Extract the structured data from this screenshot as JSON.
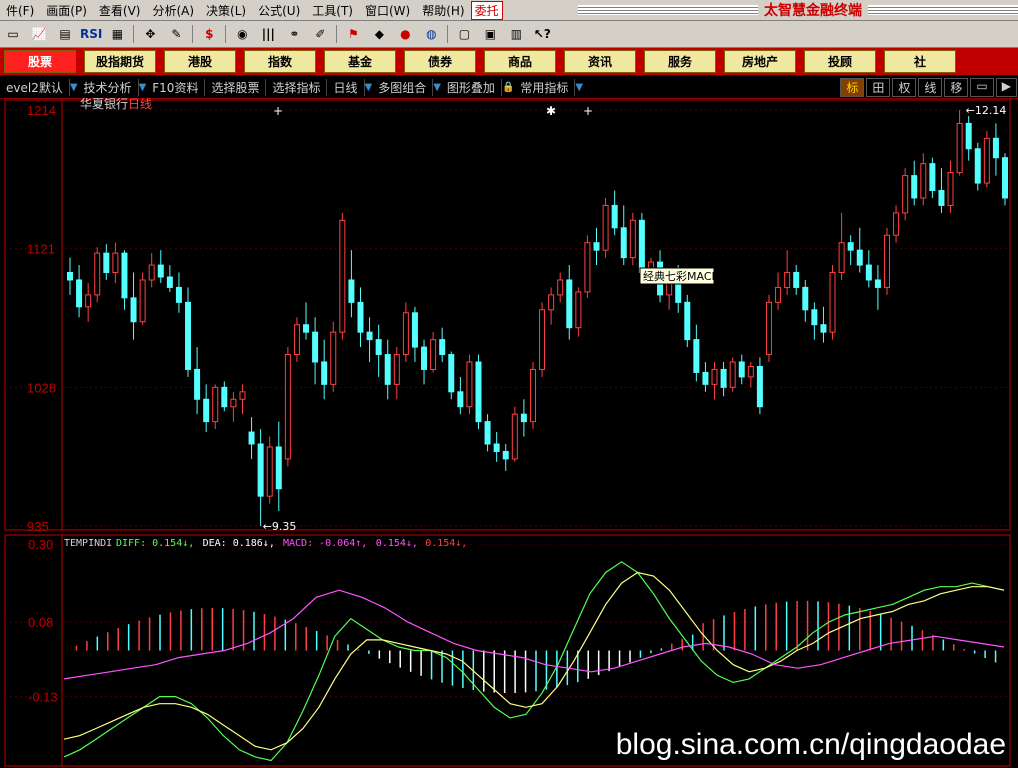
{
  "menubar": {
    "items": [
      "件(F)",
      "画面(P)",
      "查看(V)",
      "分析(A)",
      "决策(L)",
      "公式(U)",
      "工具(T)",
      "窗口(W)",
      "帮助(H)",
      "委托"
    ],
    "brand_title": "太智慧金融终端"
  },
  "toolbar": {
    "icons": [
      {
        "name": "chart-icon",
        "glyph": "▭"
      },
      {
        "name": "kline-icon",
        "glyph": "📈"
      },
      {
        "name": "minute-icon",
        "glyph": "▤"
      },
      {
        "name": "rsi-icon",
        "glyph": "RSI"
      },
      {
        "name": "grid-icon",
        "glyph": "▦"
      },
      {
        "name": "crosshair-icon",
        "glyph": "✥"
      },
      {
        "name": "ruler-icon",
        "glyph": "✎"
      },
      {
        "name": "dollar-icon",
        "glyph": "$"
      },
      {
        "name": "tape-icon",
        "glyph": "◉"
      },
      {
        "name": "bars-icon",
        "glyph": "|||"
      },
      {
        "name": "binoculars-icon",
        "glyph": "⚭"
      },
      {
        "name": "pen-icon",
        "glyph": "✐"
      },
      {
        "name": "flag-icon",
        "glyph": "⚑"
      },
      {
        "name": "diamond-icon",
        "glyph": "◆"
      },
      {
        "name": "record-icon",
        "glyph": "●"
      },
      {
        "name": "disc-icon",
        "glyph": "◍"
      },
      {
        "name": "folder-icon",
        "glyph": "▢"
      },
      {
        "name": "window-icon",
        "glyph": "▣"
      },
      {
        "name": "books-icon",
        "glyph": "▥"
      },
      {
        "name": "help-cursor-icon",
        "glyph": "↖?"
      }
    ]
  },
  "navbar": {
    "items": [
      "股票",
      "股指期货",
      "港股",
      "指数",
      "基金",
      "债券",
      "商品",
      "资讯",
      "服务",
      "房地产",
      "投顾",
      "社"
    ]
  },
  "subbar": {
    "items": [
      "evel2默认",
      "技术分析",
      "F10资料",
      "选择股票",
      "选择指标",
      "日线",
      "多图组合",
      "图形叠加",
      "常用指标"
    ],
    "modes": [
      "标",
      "田",
      "权",
      "线",
      "移",
      "▭",
      "▶"
    ]
  },
  "chart_data": [
    {
      "type": "candlestick",
      "title": "华夏银行",
      "period_label": "日线",
      "y_ticks": [
        "1214",
        "1121",
        "1028",
        "935"
      ],
      "ylim": [
        9.35,
        12.14
      ],
      "high_label": "12.14",
      "low_label": "9.35",
      "tooltip": "经典七彩MACD",
      "colors": {
        "up": "#ff4040",
        "down": "#54ffff",
        "axis": "#c00000"
      },
      "candles": [
        [
          11.05,
          11.15,
          10.9,
          11.0
        ],
        [
          11.0,
          11.1,
          10.75,
          10.82
        ],
        [
          10.82,
          10.98,
          10.72,
          10.9
        ],
        [
          10.9,
          11.22,
          10.85,
          11.18
        ],
        [
          11.18,
          11.24,
          11.0,
          11.05
        ],
        [
          11.05,
          11.25,
          10.98,
          11.18
        ],
        [
          11.18,
          11.2,
          10.8,
          10.88
        ],
        [
          10.88,
          11.05,
          10.6,
          10.72
        ],
        [
          10.72,
          11.05,
          10.7,
          11.0
        ],
        [
          11.0,
          11.18,
          10.95,
          11.1
        ],
        [
          11.1,
          11.2,
          10.98,
          11.02
        ],
        [
          11.02,
          11.1,
          10.92,
          10.95
        ],
        [
          10.95,
          11.05,
          10.78,
          10.85
        ],
        [
          10.85,
          10.95,
          10.35,
          10.4
        ],
        [
          10.4,
          10.55,
          10.1,
          10.2
        ],
        [
          10.2,
          10.3,
          9.98,
          10.05
        ],
        [
          10.05,
          10.3,
          10.0,
          10.28
        ],
        [
          10.28,
          10.32,
          10.12,
          10.15
        ],
        [
          10.15,
          10.25,
          10.05,
          10.2
        ],
        [
          10.2,
          10.3,
          10.1,
          10.25
        ],
        [
          9.98,
          10.08,
          9.8,
          9.9
        ],
        [
          9.9,
          10.0,
          9.35,
          9.55
        ],
        [
          9.55,
          9.95,
          9.5,
          9.88
        ],
        [
          9.88,
          10.05,
          9.45,
          9.6
        ],
        [
          9.8,
          10.55,
          9.75,
          10.5
        ],
        [
          10.5,
          10.75,
          10.45,
          10.7
        ],
        [
          10.7,
          10.85,
          10.6,
          10.65
        ],
        [
          10.65,
          10.75,
          10.3,
          10.45
        ],
        [
          10.45,
          10.6,
          10.2,
          10.3
        ],
        [
          10.3,
          10.72,
          10.25,
          10.65
        ],
        [
          10.65,
          11.45,
          10.6,
          11.4
        ],
        [
          11.0,
          11.2,
          10.75,
          10.85
        ],
        [
          10.85,
          10.95,
          10.55,
          10.65
        ],
        [
          10.65,
          10.75,
          10.45,
          10.6
        ],
        [
          10.6,
          10.7,
          10.35,
          10.5
        ],
        [
          10.5,
          10.6,
          10.2,
          10.3
        ],
        [
          10.3,
          10.55,
          10.2,
          10.5
        ],
        [
          10.5,
          10.85,
          10.45,
          10.78
        ],
        [
          10.78,
          10.82,
          10.45,
          10.55
        ],
        [
          10.55,
          10.6,
          10.3,
          10.4
        ],
        [
          10.4,
          10.65,
          10.38,
          10.6
        ],
        [
          10.6,
          10.68,
          10.45,
          10.5
        ],
        [
          10.5,
          10.52,
          10.2,
          10.25
        ],
        [
          10.25,
          10.35,
          10.1,
          10.15
        ],
        [
          10.15,
          10.5,
          10.1,
          10.45
        ],
        [
          10.45,
          10.5,
          10.0,
          10.05
        ],
        [
          10.05,
          10.1,
          9.85,
          9.9
        ],
        [
          9.9,
          9.98,
          9.78,
          9.85
        ],
        [
          9.85,
          9.9,
          9.72,
          9.8
        ],
        [
          9.8,
          10.15,
          9.78,
          10.1
        ],
        [
          10.1,
          10.2,
          9.95,
          10.05
        ],
        [
          10.05,
          10.45,
          10.0,
          10.4
        ],
        [
          10.4,
          10.85,
          10.35,
          10.8
        ],
        [
          10.8,
          10.95,
          10.7,
          10.9
        ],
        [
          10.9,
          11.05,
          10.85,
          11.0
        ],
        [
          11.0,
          11.1,
          10.6,
          10.68
        ],
        [
          10.68,
          10.95,
          10.62,
          10.92
        ],
        [
          10.92,
          11.3,
          10.88,
          11.25
        ],
        [
          11.25,
          11.35,
          11.1,
          11.2
        ],
        [
          11.2,
          11.55,
          11.15,
          11.5
        ],
        [
          11.5,
          11.6,
          11.3,
          11.35
        ],
        [
          11.35,
          11.5,
          11.1,
          11.15
        ],
        [
          11.15,
          11.45,
          11.1,
          11.4
        ],
        [
          11.4,
          11.45,
          11.0,
          11.05
        ],
        [
          11.05,
          11.15,
          11.0,
          11.12
        ],
        [
          11.12,
          11.2,
          10.85,
          10.9
        ],
        [
          10.9,
          11.05,
          10.8,
          11.0
        ],
        [
          11.0,
          11.1,
          10.78,
          10.85
        ],
        [
          10.85,
          10.9,
          10.55,
          10.6
        ],
        [
          10.6,
          10.7,
          10.32,
          10.38
        ],
        [
          10.38,
          10.45,
          10.25,
          10.3
        ],
        [
          10.3,
          10.45,
          10.2,
          10.4
        ],
        [
          10.4,
          10.45,
          10.22,
          10.28
        ],
        [
          10.28,
          10.48,
          10.25,
          10.45
        ],
        [
          10.45,
          10.5,
          10.3,
          10.35
        ],
        [
          10.35,
          10.45,
          10.28,
          10.42
        ],
        [
          10.42,
          10.48,
          10.1,
          10.15
        ],
        [
          10.5,
          10.9,
          10.45,
          10.85
        ],
        [
          10.85,
          11.05,
          10.8,
          10.95
        ],
        [
          10.95,
          11.2,
          10.9,
          11.05
        ],
        [
          11.05,
          11.1,
          10.9,
          10.95
        ],
        [
          10.95,
          11.0,
          10.72,
          10.8
        ],
        [
          10.8,
          10.85,
          10.6,
          10.7
        ],
        [
          10.7,
          10.82,
          10.58,
          10.65
        ],
        [
          10.65,
          11.1,
          10.6,
          11.05
        ],
        [
          11.05,
          11.45,
          11.0,
          11.25
        ],
        [
          11.25,
          11.3,
          11.1,
          11.2
        ],
        [
          11.2,
          11.35,
          11.05,
          11.1
        ],
        [
          11.1,
          11.2,
          10.95,
          11.0
        ],
        [
          11.0,
          11.1,
          10.8,
          10.95
        ],
        [
          10.95,
          11.35,
          10.9,
          11.3
        ],
        [
          11.3,
          11.5,
          11.25,
          11.45
        ],
        [
          11.45,
          11.75,
          11.4,
          11.7
        ],
        [
          11.7,
          11.8,
          11.5,
          11.55
        ],
        [
          11.55,
          11.85,
          11.5,
          11.78
        ],
        [
          11.78,
          11.82,
          11.55,
          11.6
        ],
        [
          11.6,
          11.75,
          11.45,
          11.5
        ],
        [
          11.5,
          11.8,
          11.45,
          11.72
        ],
        [
          11.72,
          12.14,
          11.7,
          12.05
        ],
        [
          12.05,
          12.1,
          11.8,
          11.88
        ],
        [
          11.88,
          11.92,
          11.6,
          11.65
        ],
        [
          11.65,
          12.0,
          11.62,
          11.95
        ],
        [
          11.95,
          12.05,
          11.7,
          11.82
        ],
        [
          11.82,
          11.85,
          11.5,
          11.55
        ]
      ],
      "up_color_label": "up",
      "candle_format": [
        "open",
        "high",
        "low",
        "close"
      ]
    },
    {
      "type": "line",
      "title": "TEMPINDI",
      "y_ticks": [
        "0.30",
        "0.08",
        "-0.13"
      ],
      "ylim": [
        -0.32,
        0.32
      ],
      "legend": [
        {
          "name": "DIFF",
          "text": "DIFF: 0.154↓,",
          "color": "#54ff54"
        },
        {
          "name": "DEA",
          "text": "DEA: 0.186↓,",
          "color": "#ffffff"
        },
        {
          "name": "MACD",
          "text": "MACD: -0.064↑,",
          "color": "#ff54ff"
        },
        {
          "name": "extra1",
          "text": "0.154↓,",
          "color": "#ff54ff"
        },
        {
          "name": "extra2",
          "text": "0.154↓,",
          "color": "#ff4040"
        }
      ],
      "series": [
        {
          "name": "DIFF",
          "color": "#54ff54",
          "values": [
            -0.3,
            -0.28,
            -0.25,
            -0.22,
            -0.19,
            -0.16,
            -0.13,
            -0.13,
            -0.15,
            -0.19,
            -0.24,
            -0.28,
            -0.3,
            -0.31,
            -0.26,
            -0.17,
            -0.07,
            0.04,
            0.09,
            0.06,
            0.03,
            0.01,
            0.0,
            0.0,
            -0.02,
            -0.06,
            -0.11,
            -0.16,
            -0.19,
            -0.18,
            -0.12,
            -0.04,
            0.06,
            0.16,
            0.22,
            0.25,
            0.22,
            0.16,
            0.09,
            0.03,
            -0.03,
            -0.07,
            -0.09,
            -0.08,
            -0.05,
            -0.02,
            0.01,
            0.05,
            0.08,
            0.1,
            0.11,
            0.12,
            0.13,
            0.15,
            0.17,
            0.18,
            0.18,
            0.19,
            0.18,
            0.17
          ]
        },
        {
          "name": "DEA",
          "color": "#ffff80",
          "values": [
            -0.25,
            -0.24,
            -0.22,
            -0.2,
            -0.18,
            -0.16,
            -0.15,
            -0.15,
            -0.16,
            -0.18,
            -0.21,
            -0.24,
            -0.27,
            -0.28,
            -0.26,
            -0.22,
            -0.16,
            -0.08,
            -0.01,
            0.03,
            0.03,
            0.02,
            0.01,
            0.0,
            -0.01,
            -0.03,
            -0.07,
            -0.11,
            -0.15,
            -0.16,
            -0.15,
            -0.1,
            -0.03,
            0.05,
            0.13,
            0.19,
            0.22,
            0.21,
            0.17,
            0.11,
            0.05,
            0.0,
            -0.04,
            -0.06,
            -0.05,
            -0.03,
            0.0,
            0.02,
            0.05,
            0.07,
            0.09,
            0.1,
            0.11,
            0.13,
            0.14,
            0.16,
            0.17,
            0.18,
            0.18,
            0.17
          ]
        },
        {
          "name": "MACD",
          "color": "#ff54ff",
          "values": [
            -0.08,
            -0.07,
            -0.06,
            -0.05,
            -0.04,
            -0.02,
            -0.01,
            0.0,
            0.02,
            0.05,
            0.09,
            0.15,
            0.17,
            0.15,
            0.12,
            0.08,
            0.05,
            0.02,
            0.0,
            -0.01,
            -0.02,
            -0.04,
            -0.05,
            -0.06,
            -0.05,
            -0.03,
            -0.01,
            0.01,
            0.02,
            0.01,
            -0.01,
            -0.04,
            -0.05,
            -0.04,
            -0.02,
            0.0,
            0.02,
            0.03,
            0.04,
            0.03,
            0.02,
            0.01
          ]
        }
      ]
    }
  ],
  "watermark": "blog.sina.com.cn/qingdaodae"
}
